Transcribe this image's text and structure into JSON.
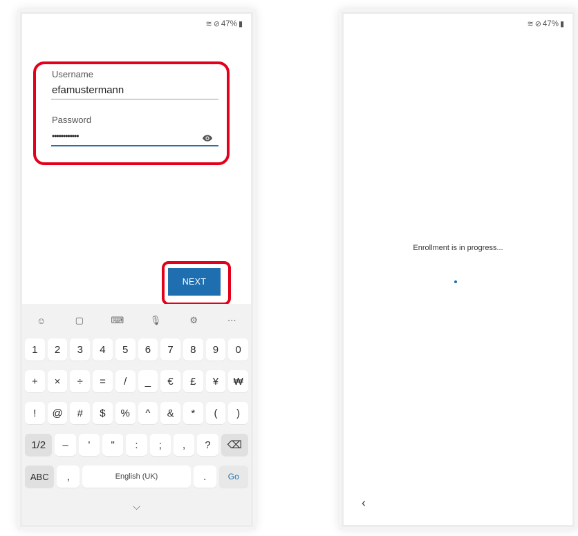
{
  "status_bar": {
    "battery": "47%",
    "icons": [
      "wifi-icon",
      "do-not-disturb-icon",
      "battery-icon"
    ]
  },
  "login": {
    "username_label": "Username",
    "username_value": "efamustermann",
    "password_label": "Password",
    "password_value": "••••••••••••",
    "next_label": "NEXT"
  },
  "keyboard": {
    "toolbar": [
      "emoji-icon",
      "clipboard-icon",
      "keyboard-icon",
      "mic-icon",
      "settings-icon",
      "more-icon"
    ],
    "row_numbers": [
      "1",
      "2",
      "3",
      "4",
      "5",
      "6",
      "7",
      "8",
      "9",
      "0"
    ],
    "row_sym1": [
      "+",
      "×",
      "÷",
      "=",
      "/",
      "_",
      "€",
      "£",
      "¥",
      "₩"
    ],
    "row_sym2": [
      "!",
      "@",
      "#",
      "$",
      "%",
      "^",
      "&",
      "*",
      "(",
      ")"
    ],
    "row_sym3": [
      "1/2",
      "–",
      "'",
      "\"",
      ":",
      ";",
      ",",
      "?"
    ],
    "abc": "ABC",
    "comma": ",",
    "space": "English (UK)",
    "period": ".",
    "go": "Go"
  },
  "enrollment": {
    "message": "Enrollment is in progress..."
  },
  "colors": {
    "accent": "#1f6fb0",
    "highlight": "#e3001b"
  }
}
